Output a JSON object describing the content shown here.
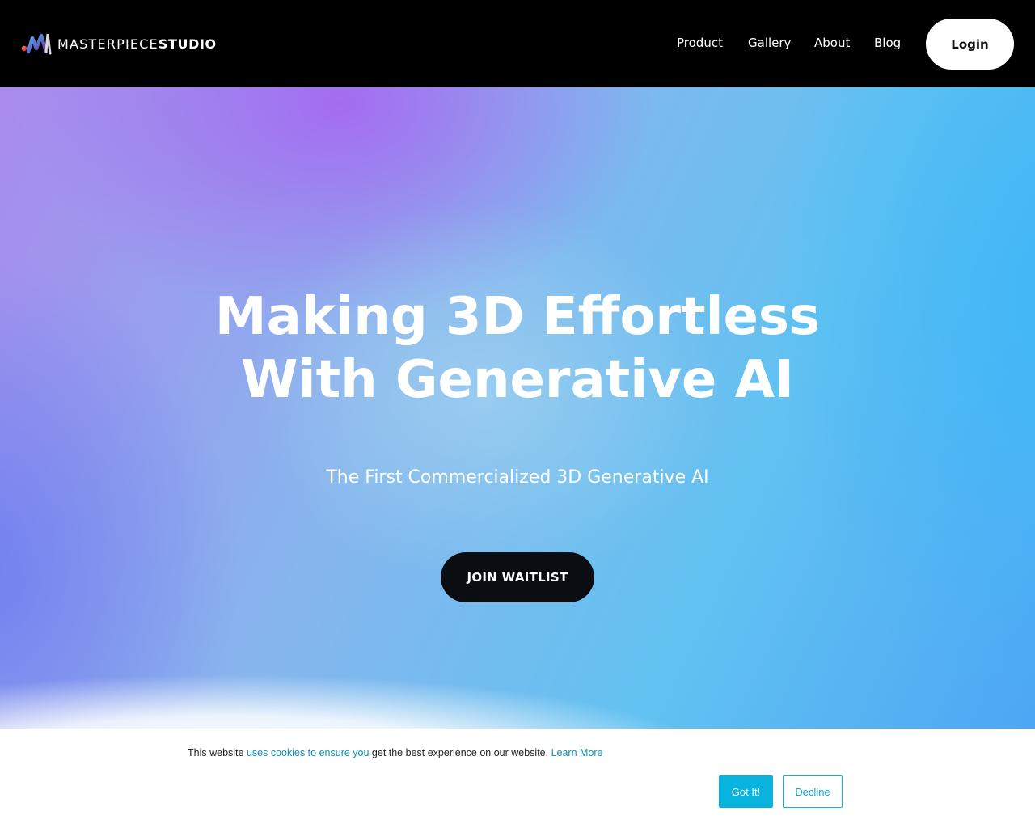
{
  "brand": {
    "name_light": "MASTERPIECE",
    "name_bold": "STUDIO",
    "logo_icon": "masterpiece-m-logo-icon"
  },
  "nav": {
    "items": [
      {
        "label": "Product"
      },
      {
        "label": "Gallery"
      },
      {
        "label": "About"
      },
      {
        "label": "Blog"
      }
    ],
    "login_label": "Login"
  },
  "hero": {
    "headline_line1": "Making 3D Effortless",
    "headline_line2": "With Generative AI",
    "subhead": "The First Commercialized 3D Generative AI",
    "cta_label": "JOIN WAITLIST"
  },
  "cookie_banner": {
    "text_before": "This website ",
    "link_text": "uses cookies to ensure you",
    "text_after": " get the best experience on our website. ",
    "learn_more": "Learn More",
    "accept_label": "Got It!",
    "decline_label": "Decline"
  },
  "colors": {
    "topbar_bg": "#000000",
    "cta_bg": "#0a0d12",
    "cookie_accent": "#08b4de",
    "cookie_link": "#0c8fb0"
  }
}
